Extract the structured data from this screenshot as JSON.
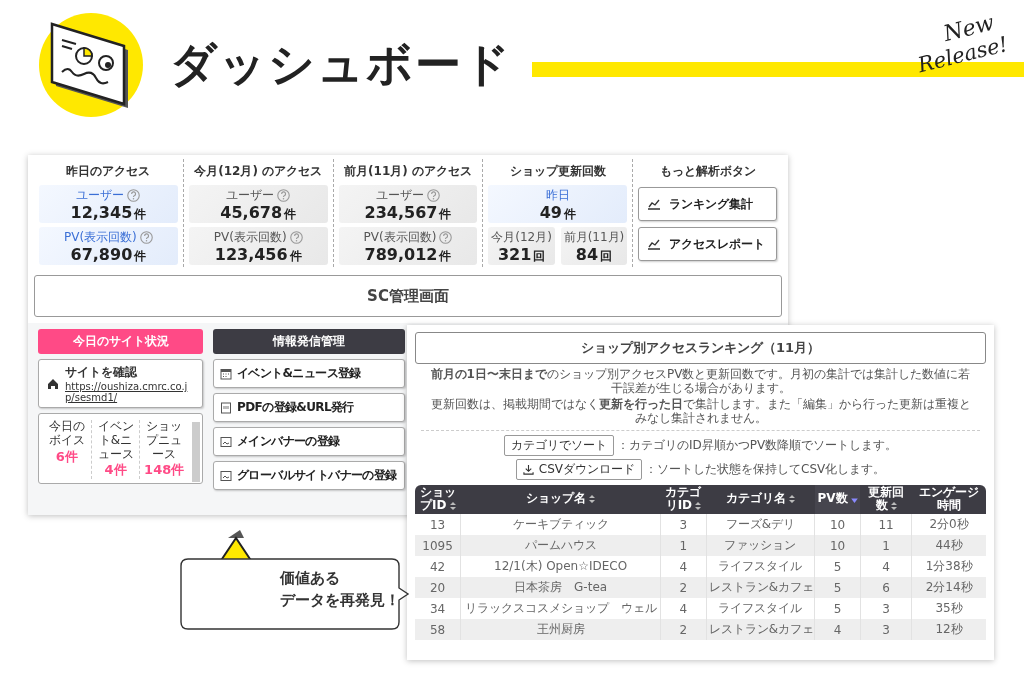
{
  "header": {
    "title": "ダッシュボード",
    "tagline": [
      "New",
      "Release!"
    ]
  },
  "dashboard": {
    "stats": [
      {
        "kind": "access",
        "heading": "昨日のアクセス",
        "cards": [
          {
            "label": "ユーザー",
            "value": "12,345",
            "unit": "件",
            "highlight": true,
            "help": true
          },
          {
            "label": "PV(表示回数)",
            "value": "67,890",
            "unit": "件",
            "highlight": true,
            "help": true
          }
        ]
      },
      {
        "kind": "access",
        "heading": "今月(12月) のアクセス",
        "cards": [
          {
            "label": "ユーザー",
            "value": "45,678",
            "unit": "件",
            "highlight": false,
            "help": true
          },
          {
            "label": "PV(表示回数)",
            "value": "123,456",
            "unit": "件",
            "highlight": false,
            "help": true
          }
        ]
      },
      {
        "kind": "access",
        "heading": "前月(11月) のアクセス",
        "cards": [
          {
            "label": "ユーザー",
            "value": "234,567",
            "unit": "件",
            "highlight": false,
            "help": true
          },
          {
            "label": "PV(表示回数)",
            "value": "789,012",
            "unit": "件",
            "highlight": false,
            "help": true
          }
        ]
      },
      {
        "kind": "updates",
        "heading": "ショップ更新回数",
        "cards": [
          {
            "label": "昨日",
            "value": "49",
            "unit": "件",
            "highlight": true,
            "help": false
          },
          {
            "label": "今月(12月)",
            "value": "321",
            "unit": "回",
            "highlight": false,
            "help": false
          },
          {
            "label": "前月(11月)",
            "value": "84",
            "unit": "回",
            "highlight": false,
            "help": false
          }
        ]
      },
      {
        "kind": "buttons",
        "heading": "もっと解析ボタン",
        "buttons": [
          "ランキング集計",
          "アクセスレポート"
        ]
      }
    ],
    "sc_title": "SC管理画面",
    "today": {
      "header": "今日のサイト状況",
      "site_label": "サイトを確認",
      "site_url": "https://oushiza.cmrc.co.jp/sesmd1/",
      "counts": [
        {
          "label": "今日のボイス",
          "value": "6件"
        },
        {
          "label": "イベント&ニュース",
          "value": "4件"
        },
        {
          "label": "ショップニュース",
          "value": "148件"
        }
      ]
    },
    "info": {
      "header": "情報発信管理",
      "buttons": [
        {
          "kind": "calendar",
          "label": "イベント&ニュース登録"
        },
        {
          "kind": "pdf",
          "label": "PDFの登録&URL発行"
        },
        {
          "kind": "image",
          "label": "メインバナーの登録"
        },
        {
          "kind": "image",
          "label": "グローバルサイトバナーの登録"
        }
      ]
    }
  },
  "ranking": {
    "title": "ショップ別アクセスランキング（11月）",
    "notes": [
      "**前月の1日〜末日まで**のショップ別アクセスPV数と更新回数です。月初の集計では集計した数値に若干誤差が生じる場合があります。",
      "更新回数は、掲載期間ではなく**更新を行った日**で集計します。また「編集」から行った更新は重複とみなし集計されません。"
    ],
    "actions": [
      {
        "kind": "sort",
        "button": "カテゴリでソート",
        "note": "：カテゴリのID昇順かつPV数降順でソートします。"
      },
      {
        "kind": "download",
        "button": "CSVダウンロード",
        "note": "：ソートした状態を保持してCSV化します。"
      }
    ],
    "table": {
      "columns": [
        {
          "label": "ショップID",
          "sortable": true,
          "sorted": false
        },
        {
          "label": "ショップ名",
          "sortable": true,
          "sorted": false
        },
        {
          "label": "カテゴリID",
          "sortable": true,
          "sorted": false
        },
        {
          "label": "カテゴリ名",
          "sortable": true,
          "sorted": false
        },
        {
          "label": "PV数",
          "sortable": true,
          "sorted": true
        },
        {
          "label": "更新回数",
          "sortable": true,
          "sorted": false
        },
        {
          "label": "エンゲージ時間",
          "sortable": false
        }
      ],
      "rows": [
        [
          "13",
          "ケーキブティック",
          "3",
          "フーズ&デリ",
          "10",
          "11",
          "2分0秒"
        ],
        [
          "1095",
          "パームハウス",
          "1",
          "ファッション",
          "10",
          "1",
          "44秒"
        ],
        [
          "42",
          "12/1(木) Open☆IDECO",
          "4",
          "ライフスタイル",
          "5",
          "4",
          "1分38秒"
        ],
        [
          "20",
          "日本茶房　G-tea",
          "2",
          "レストラン&カフェ",
          "5",
          "6",
          "2分14秒"
        ],
        [
          "34",
          "リラックスコスメショップ　ウェル",
          "4",
          "ライフスタイル",
          "5",
          "3",
          "35秒"
        ],
        [
          "58",
          "王州厨房",
          "2",
          "レストラン&カフェ",
          "4",
          "3",
          "12秒"
        ]
      ]
    }
  },
  "callout": {
    "lines": [
      "価値ある",
      "データを再発見！"
    ]
  }
}
